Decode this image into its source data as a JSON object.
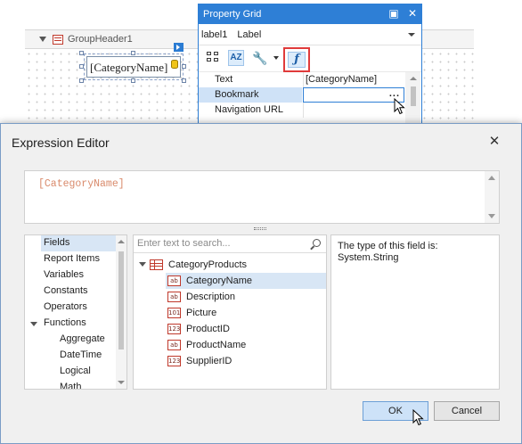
{
  "designer": {
    "band_label": "GroupHeader1",
    "label_text": "[CategoryName]"
  },
  "property_grid": {
    "title": "Property Grid",
    "object_name": "label1",
    "object_type": "Label",
    "rows": [
      {
        "name": "Text",
        "value": "[CategoryName]"
      },
      {
        "name": "Bookmark",
        "value": ""
      },
      {
        "name": "Navigation URL",
        "value": ""
      }
    ],
    "ellipsis": "..."
  },
  "dialog": {
    "title": "Expression Editor",
    "expression": "[CategoryName]",
    "categories": [
      {
        "label": "Fields",
        "selected": true
      },
      {
        "label": "Report Items"
      },
      {
        "label": "Variables"
      },
      {
        "label": "Constants"
      },
      {
        "label": "Operators"
      },
      {
        "label": "Functions",
        "expanded": true
      },
      {
        "label": "Aggregate",
        "child": true
      },
      {
        "label": "DateTime",
        "child": true
      },
      {
        "label": "Logical",
        "child": true
      },
      {
        "label": "Math",
        "child": true
      }
    ],
    "search_placeholder": "Enter text to search...",
    "data_source": {
      "label": "CategoryProducts",
      "icon": "table-icon"
    },
    "fields": [
      {
        "label": "CategoryName",
        "type_badge": "ab",
        "selected": true
      },
      {
        "label": "Description",
        "type_badge": "ab"
      },
      {
        "label": "Picture",
        "type_badge": "101"
      },
      {
        "label": "ProductID",
        "type_badge": "123"
      },
      {
        "label": "ProductName",
        "type_badge": "ab"
      },
      {
        "label": "SupplierID",
        "type_badge": "123"
      }
    ],
    "description_line1": "The type of this field is:",
    "description_line2": "System.String",
    "ok_label": "OK",
    "cancel_label": "Cancel"
  },
  "colors": {
    "accent": "#2e7fd6",
    "highlight_border": "#e03b3b",
    "expression_text": "#d98a6b"
  }
}
